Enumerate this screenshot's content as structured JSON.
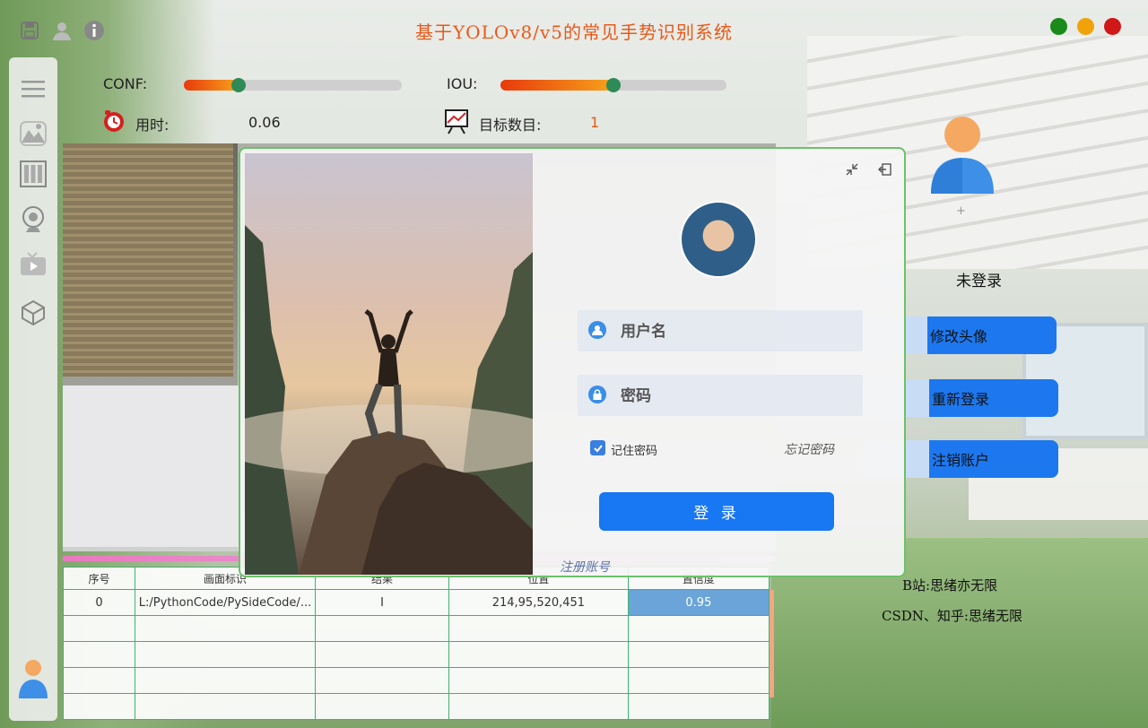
{
  "app": {
    "title": "基于YOLOv8/v5的常见手势识别系统"
  },
  "window_controls": {
    "colors": [
      "#1a8a1a",
      "#f0a20a",
      "#d01818"
    ]
  },
  "params": {
    "conf_label": "CONF:",
    "conf_value": 0.25,
    "iou_label": "IOU:",
    "iou_value": 0.5,
    "time_label": "用时:",
    "time_value": "0.06",
    "count_label": "目标数目:",
    "count_value": "1"
  },
  "login": {
    "username_placeholder": "用户名",
    "password_placeholder": "密码",
    "remember_label": "记住密码",
    "remember_checked": true,
    "forgot_label": "忘记密码",
    "login_label": "登 录",
    "register_label": "注册账号"
  },
  "user_panel": {
    "plus": "+",
    "status": "未登录",
    "change_avatar": "修改头像",
    "relogin": "重新登录",
    "logout": "注销账户",
    "bilibili": "B站:思绪亦无限",
    "csdn": "CSDN、知乎:思绪无限"
  },
  "table": {
    "headers": [
      "序号",
      "画面标识",
      "结果",
      "位置",
      "置信度"
    ],
    "rows": [
      [
        "0",
        "L:/PythonCode/PySideCode/...",
        "I",
        "214,95,520,451",
        "0.95"
      ]
    ]
  },
  "colors": {
    "accent": "#1877f2",
    "title": "#e8591a",
    "table_border": "#3cb371",
    "dialog_border": "#6cc16a"
  }
}
